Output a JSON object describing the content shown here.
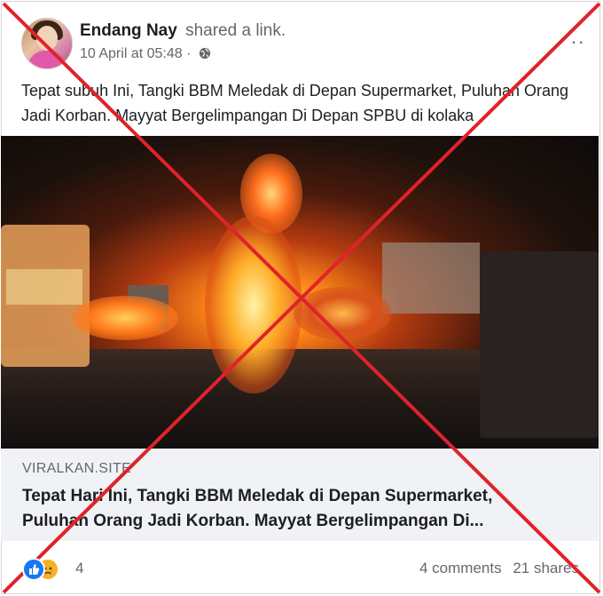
{
  "post": {
    "author": "Endang Nay",
    "action": "shared a link.",
    "timestamp": "10 April at 05:48",
    "dot": "·",
    "audience_icon": "globe-icon",
    "more_label": "··",
    "text": "Tepat subuh Ini, Tangki BBM Meledak di Depan Supermarket, Puluhan Orang Jadi Korban. Mayyat Bergelimpangan Di Depan SPBU di kolaka"
  },
  "link": {
    "domain": "VIRALKAN.SITE",
    "title": "Tepat Hari Ini, Tangki BBM Meledak di Depan Supermarket,\nPuluhan Orang Jadi Korban. Mayyat Bergelimpangan Di..."
  },
  "footer": {
    "reaction_icons": [
      "like-icon",
      "sad-icon"
    ],
    "reaction_count": "4",
    "comments": "4 comments",
    "shares": "21 shares"
  },
  "overlay": {
    "cross_color": "#e0222a"
  }
}
